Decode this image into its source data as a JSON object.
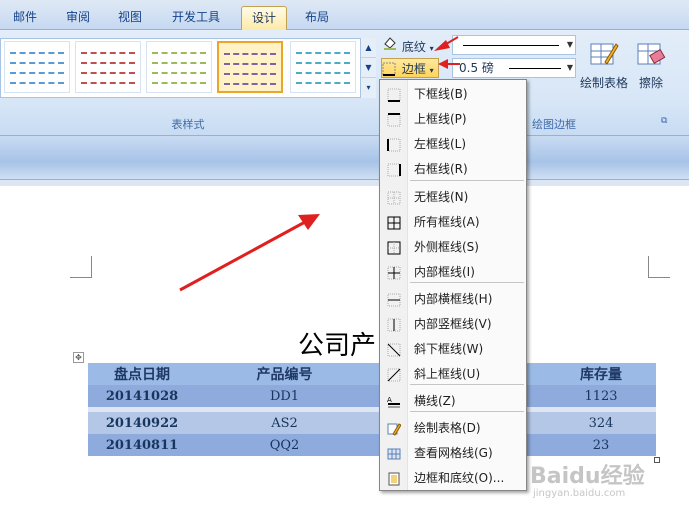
{
  "tabs": [
    "邮件",
    "审阅",
    "视图",
    "开发工具",
    "设计",
    "布局"
  ],
  "active_tab": "设计",
  "ribbon": {
    "group_table_styles": "表样式",
    "group_draw_borders": "绘图边框",
    "shading_label": "底纹",
    "borders_label": "边框",
    "pen_weight": "0.5 磅",
    "draw_table_label": "绘制表格",
    "eraser_label": "擦除"
  },
  "border_menu": [
    {
      "icon": "bottom-border-icon",
      "label": "下框线(B)"
    },
    {
      "icon": "top-border-icon",
      "label": "上框线(P)"
    },
    {
      "icon": "left-border-icon",
      "label": "左框线(L)"
    },
    {
      "icon": "right-border-icon",
      "label": "右框线(R)"
    },
    {
      "icon": "no-border-icon",
      "label": "无框线(N)"
    },
    {
      "icon": "all-borders-icon",
      "label": "所有框线(A)"
    },
    {
      "icon": "outside-borders-icon",
      "label": "外侧框线(S)"
    },
    {
      "icon": "inside-borders-icon",
      "label": "内部框线(I)"
    },
    {
      "icon": "inside-horizontal-border-icon",
      "label": "内部横框线(H)"
    },
    {
      "icon": "inside-vertical-border-icon",
      "label": "内部竖框线(V)"
    },
    {
      "icon": "diagonal-down-border-icon",
      "label": "斜下框线(W)"
    },
    {
      "icon": "diagonal-up-border-icon",
      "label": "斜上框线(U)"
    },
    {
      "icon": "horizontal-line-icon",
      "label": "横线(Z)"
    },
    {
      "icon": "draw-table-icon",
      "label": "绘制表格(D)"
    },
    {
      "icon": "view-gridlines-icon",
      "label": "查看网格线(G)"
    },
    {
      "icon": "borders-shading-icon",
      "label": "边框和底纹(O)..."
    }
  ],
  "document": {
    "title": "公司产",
    "headers": [
      "盘点日期",
      "产品编号",
      "",
      "库存量"
    ],
    "rows": [
      [
        "20141028",
        "DD1",
        "",
        "1123"
      ],
      [
        "20140922",
        "AS2",
        "",
        "324"
      ],
      [
        "20140811",
        "QQ2",
        "",
        "23"
      ]
    ]
  },
  "watermark": {
    "text": "Baidu经验",
    "url_text": "jingyan.baidu.com"
  },
  "colors": {
    "accent_arrow": "#e02020",
    "menu_highlight": "#ffe6a0",
    "ribbon_bg": "#dbe7f6"
  }
}
